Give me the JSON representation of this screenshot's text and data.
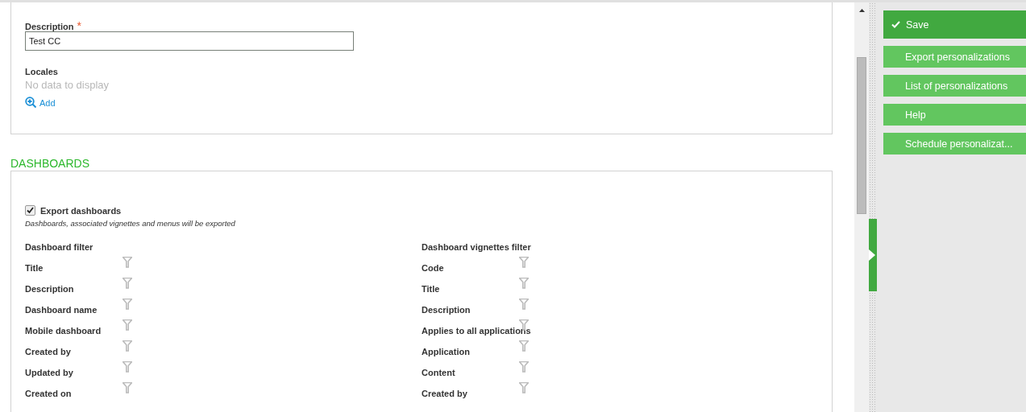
{
  "description": {
    "label": "Description",
    "required_mark": "*",
    "value": "Test CC"
  },
  "locales": {
    "label": "Locales",
    "empty_text": "No data to display",
    "add_link": "Add"
  },
  "dashboards": {
    "heading": "DASHBOARDS",
    "export": {
      "label": "Export dashboards",
      "checked": true,
      "hint": "Dashboards, associated vignettes and menus will be exported"
    },
    "filters": [
      {
        "title": "Dashboard filter",
        "fields": [
          "Title",
          "Description",
          "Dashboard name",
          "Mobile dashboard",
          "Created by",
          "Updated by",
          "Created on"
        ]
      },
      {
        "title": "Dashboard vignettes filter",
        "fields": [
          "Code",
          "Title",
          "Description",
          "Applies to all applications",
          "Application",
          "Content",
          "Created by"
        ]
      }
    ]
  },
  "actions": [
    {
      "label": "Save",
      "kind": "primary"
    },
    {
      "label": "Export personalizations",
      "kind": "secondary"
    },
    {
      "label": "List of personalizations",
      "kind": "secondary"
    },
    {
      "label": "Help",
      "kind": "secondary"
    },
    {
      "label": "Schedule personalizat...",
      "kind": "secondary"
    }
  ]
}
